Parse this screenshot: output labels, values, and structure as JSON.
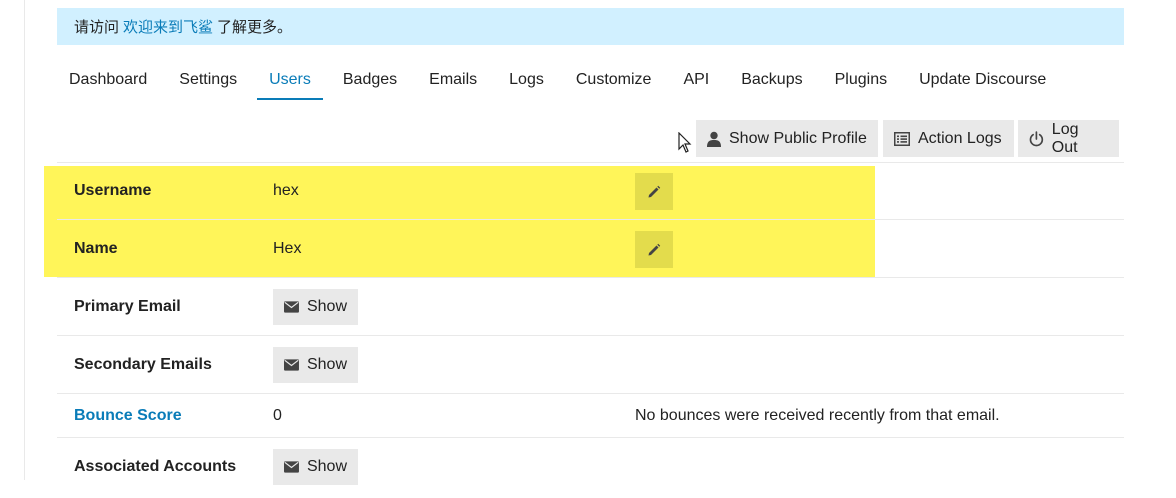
{
  "notice": {
    "prefix": "请访问",
    "link_text": "欢迎来到飞鲨",
    "suffix": "了解更多。"
  },
  "nav": {
    "tabs": [
      "Dashboard",
      "Settings",
      "Users",
      "Badges",
      "Emails",
      "Logs",
      "Customize",
      "API",
      "Backups",
      "Plugins",
      "Update Discourse"
    ],
    "active": "Users"
  },
  "actions": {
    "show_public_profile": "Show Public Profile",
    "action_logs": "Action Logs",
    "log_out": "Log Out"
  },
  "details": {
    "username": {
      "label": "Username",
      "value": "hex"
    },
    "name": {
      "label": "Name",
      "value": "Hex"
    },
    "primary_email": {
      "label": "Primary Email",
      "button": "Show"
    },
    "secondary_emails": {
      "label": "Secondary Emails",
      "button": "Show"
    },
    "bounce_score": {
      "label": "Bounce Score",
      "value": "0",
      "note": "No bounces were received recently from that email."
    },
    "associated_accounts": {
      "label": "Associated Accounts",
      "button": "Show"
    }
  },
  "colors": {
    "accent": "#0a7cb8",
    "notice_bg": "#d1f0ff",
    "highlight": "#fff559",
    "button_bg": "#e9e9e9"
  }
}
